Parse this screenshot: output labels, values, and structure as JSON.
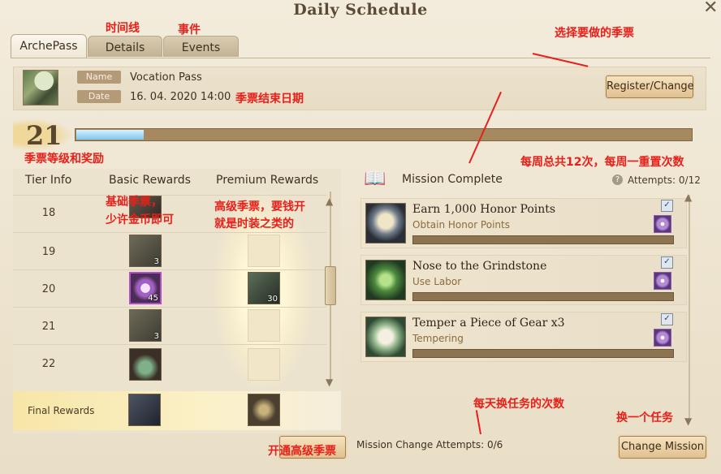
{
  "window": {
    "title": "Daily Schedule",
    "close_label": "✕"
  },
  "tabs": [
    "ArchePass",
    "Details",
    "Events"
  ],
  "pass": {
    "name_label": "Name",
    "name": "Vocation Pass",
    "date_label": "Date",
    "date": "16. 04. 2020 14:00",
    "register_button": "Register/Change"
  },
  "level": {
    "value": "21",
    "progress": 0.11
  },
  "tiers": {
    "headers": {
      "tier": "Tier Info",
      "basic": "Basic Rewards",
      "premium": "Premium Rewards"
    },
    "rows": [
      {
        "tier": "18",
        "basic_count": "",
        "premium_count": ""
      },
      {
        "tier": "19",
        "basic_count": "3",
        "premium_count": ""
      },
      {
        "tier": "20",
        "basic_count": "45",
        "premium_count": "30"
      },
      {
        "tier": "21",
        "basic_count": "3",
        "premium_count": ""
      },
      {
        "tier": "22",
        "basic_count": "",
        "premium_count": ""
      }
    ],
    "final_label": "Final Rewards"
  },
  "missions": {
    "header": "Mission Complete",
    "attempts": "Attempts: 0/12",
    "items": [
      {
        "title": "Earn 1,000 Honor Points",
        "subtitle": "Obtain Honor Points",
        "icon": "scroll-icon"
      },
      {
        "title": "Nose to the Grindstone",
        "subtitle": "Use Labor",
        "icon": "sprout-icon"
      },
      {
        "title": "Temper a Piece of Gear x3",
        "subtitle": "Tempering",
        "icon": "book-icon"
      }
    ],
    "change_attempts": "Mission Change Attempts: 0/6",
    "change_button": "Change Mission"
  },
  "annotations": {
    "timeline": "时间线",
    "events": "事件",
    "choose_pass": "选择要做的季票",
    "end_date": "季票结束日期",
    "level_rewards": "季票等级和奖励",
    "weekly": "每周总共12次，每周一重置次数",
    "basic_1": "基础季票，",
    "basic_2": "少许金币即可",
    "premium_1": "高级季票，要钱开",
    "premium_2": "就是时装之类的",
    "daily_change": "每天换任务的次数",
    "change_one": "换一个任务",
    "open_premium": "开通高级季票"
  }
}
